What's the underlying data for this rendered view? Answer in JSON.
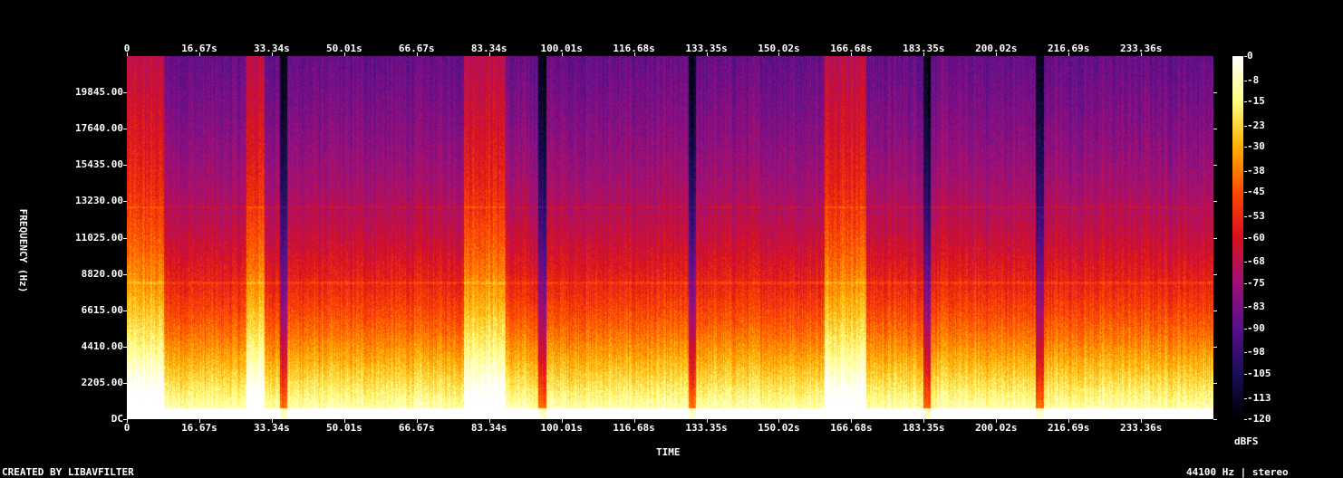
{
  "chart_data": {
    "type": "heatmap",
    "title": "",
    "xlabel": "TIME",
    "ylabel": "FREQUENCY (Hz)",
    "x_ticks": [
      "0",
      "16.67s",
      "33.34s",
      "50.01s",
      "66.67s",
      "83.34s",
      "100.01s",
      "116.68s",
      "133.35s",
      "150.02s",
      "166.68s",
      "183.35s",
      "200.02s",
      "216.69s",
      "233.36s"
    ],
    "x_tick_values": [
      0,
      16.67,
      33.34,
      50.01,
      66.67,
      83.34,
      100.01,
      116.68,
      133.35,
      150.02,
      166.68,
      183.35,
      200.02,
      216.69,
      233.36
    ],
    "x_range": [
      0,
      250
    ],
    "y_ticks": [
      "DC",
      "2205.00",
      "4410.00",
      "6615.00",
      "8820.00",
      "11025.00",
      "13230.00",
      "15435.00",
      "17640.00",
      "19845.00"
    ],
    "y_tick_values": [
      0,
      2205,
      4410,
      6615,
      8820,
      11025,
      13230,
      15435,
      17640,
      19845
    ],
    "y_range": [
      0,
      22050
    ],
    "colorbar": {
      "label": "dBFS",
      "ticks": [
        "0",
        "-8",
        "-15",
        "-23",
        "-30",
        "-38",
        "-45",
        "-53",
        "-60",
        "-68",
        "-75",
        "-83",
        "-90",
        "-98",
        "-105",
        "-113",
        "-120"
      ],
      "range": [
        -120,
        0
      ],
      "colormap": [
        "#000000",
        "#1a0e5a",
        "#5a0f8c",
        "#a0107a",
        "#d81020",
        "#ff4a00",
        "#ffb000",
        "#ffff80",
        "#ffffff"
      ]
    },
    "quiet_segments_s": [
      [
        8.5,
        27.5
      ],
      [
        38,
        66.5
      ],
      [
        92,
        161
      ],
      [
        170,
        250
      ]
    ],
    "loud_segments_s": [
      [
        0,
        8.5
      ],
      [
        27.5,
        31.5
      ],
      [
        77.5,
        87
      ],
      [
        160.5,
        170
      ]
    ],
    "dips_s": [
      36,
      95.5,
      130,
      184,
      210
    ]
  },
  "footer": {
    "left": "CREATED BY LIBAVFILTER",
    "right": "44100 Hz | stereo"
  }
}
